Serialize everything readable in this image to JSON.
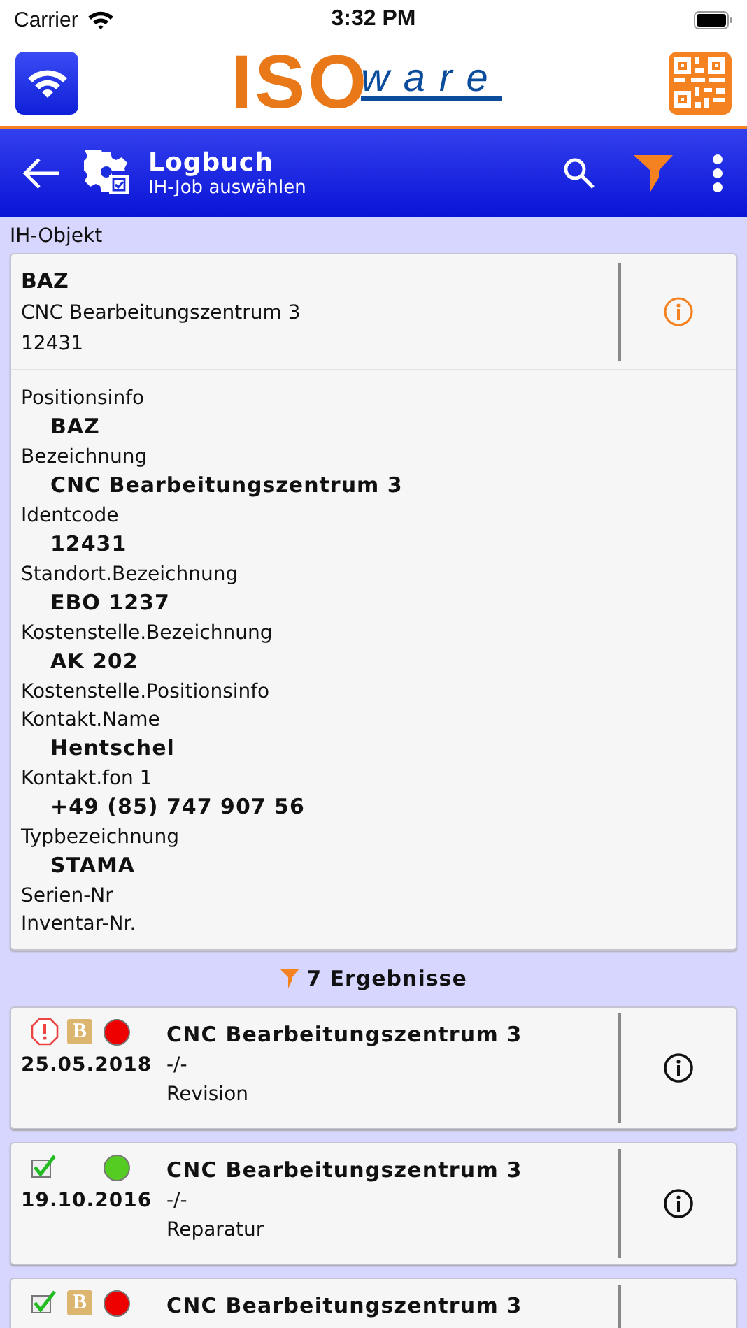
{
  "status_bar": {
    "carrier": "Carrier",
    "time": "3:32 PM"
  },
  "logo": {
    "main": "ISO",
    "tail": "ware"
  },
  "toolbar": {
    "title": "Logbuch",
    "subtitle": "IH-Job auswählen",
    "filter_active": true
  },
  "object_section": {
    "heading": "IH-Objekt",
    "summary": [
      "BAZ",
      "CNC Bearbeitungszentrum 3",
      "12431"
    ],
    "fields": [
      {
        "label": "Positionsinfo",
        "value": "BAZ"
      },
      {
        "label": "Bezeichnung",
        "value": "CNC Bearbeitungszentrum 3"
      },
      {
        "label": "Identcode",
        "value": "12431"
      },
      {
        "label": "Standort.Bezeichnung",
        "value": "EBO 1237"
      },
      {
        "label": "Kostenstelle.Bezeichnung",
        "value": "AK 202"
      },
      {
        "label": "Kostenstelle.Positionsinfo"
      },
      {
        "label": "Kontakt.Name",
        "value": "Hentschel"
      },
      {
        "label": "Kontakt.fon 1",
        "value": "+49 (85) 747 907 56"
      },
      {
        "label": "Typbezeichnung",
        "value": "STAMA"
      },
      {
        "label": "Serien-Nr"
      },
      {
        "label": "Inventar-Nr."
      }
    ]
  },
  "results": {
    "count": "7 Ergebnisse",
    "items": [
      {
        "title": "CNC Bearbeitungszentrum 3",
        "date": "25.05.2018",
        "line2": "-/-",
        "type": "Revision",
        "kind": "alert",
        "badge": "B",
        "color": "#ee0000"
      },
      {
        "title": "CNC Bearbeitungszentrum 3",
        "date": "19.10.2016",
        "line2": "-/-",
        "type": "Reparatur",
        "kind": "done",
        "color": "#55cc22"
      },
      {
        "title": "CNC Bearbeitungszentrum 3",
        "kind": "done",
        "badge": "B",
        "color": "#ee0000"
      }
    ]
  }
}
